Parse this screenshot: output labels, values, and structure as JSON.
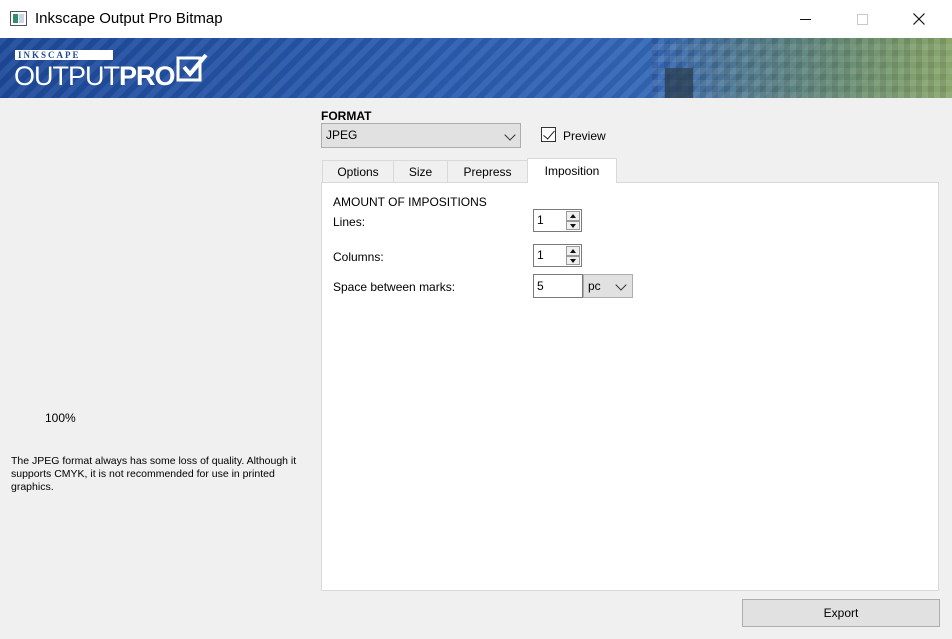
{
  "window": {
    "title": "Inkscape Output Pro Bitmap"
  },
  "banner": {
    "logo_small": "INKSCAPE",
    "logo_main": "OUTPUT",
    "logo_pro": "PRO"
  },
  "left": {
    "zoom": "100%",
    "note": "The JPEG format always has some loss of quality. Although it supports CMYK, it is not recommended for use in printed graphics."
  },
  "format": {
    "label": "FORMAT",
    "selected": "JPEG",
    "preview_label": "Preview",
    "preview_checked": true
  },
  "tabs": [
    {
      "label": "Options"
    },
    {
      "label": "Size"
    },
    {
      "label": "Prepress"
    },
    {
      "label": "Imposition",
      "active": true
    }
  ],
  "imposition": {
    "section_title": "AMOUNT OF IMPOSITIONS",
    "lines_label": "Lines:",
    "lines_value": "1",
    "columns_label": "Columns:",
    "columns_value": "1",
    "space_label": "Space between marks:",
    "space_value": "5",
    "space_unit": "pc"
  },
  "actions": {
    "export_label": "Export"
  },
  "colors": {
    "banner_blue": "#2a5cb0",
    "window_bg": "#f0f0f0"
  }
}
